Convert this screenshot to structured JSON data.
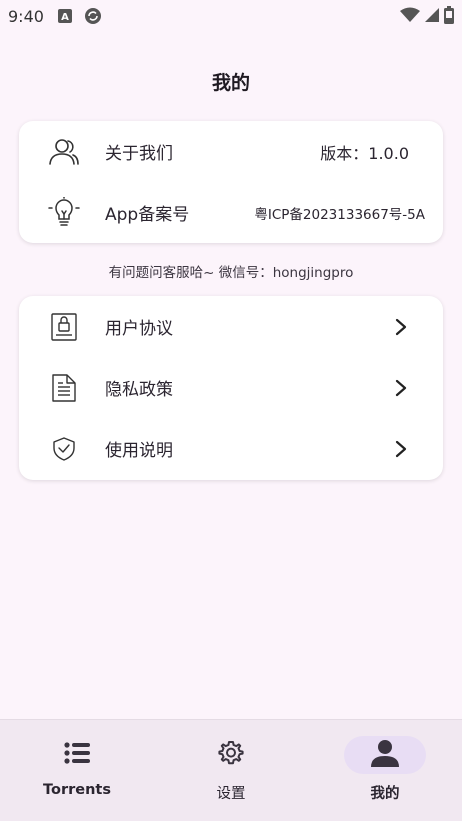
{
  "status_bar": {
    "time": "9:40",
    "icons": [
      "font-a-icon",
      "sync-icon",
      "wifi-icon",
      "signal-icon",
      "battery-icon"
    ]
  },
  "header": {
    "title": "我的"
  },
  "about_card": {
    "items": [
      {
        "icon": "people-icon",
        "label": "关于我们",
        "value": "版本：1.0.0"
      },
      {
        "icon": "lightbulb-icon",
        "label": "App备案号",
        "value": "粤ICP备2023133667号-5A"
      }
    ]
  },
  "contact_note": "有问题问客服哈~ 微信号：hongjingpro",
  "policy_card": {
    "items": [
      {
        "icon": "agreement-icon",
        "label": "用户协议"
      },
      {
        "icon": "document-icon",
        "label": "隐私政策"
      },
      {
        "icon": "shield-check-icon",
        "label": "使用说明"
      }
    ]
  },
  "bottom_nav": {
    "items": [
      {
        "icon": "list-icon",
        "label": "Torrents",
        "active": false
      },
      {
        "icon": "gear-icon",
        "label": "设置",
        "active": false
      },
      {
        "icon": "person-icon",
        "label": "我的",
        "active": true
      }
    ]
  },
  "colors": {
    "background": "#fcf4fb",
    "card": "#ffffff",
    "nav_background": "#f1e8f1",
    "nav_active_pill": "#e8ddf4",
    "text_primary": "#2b2530"
  }
}
